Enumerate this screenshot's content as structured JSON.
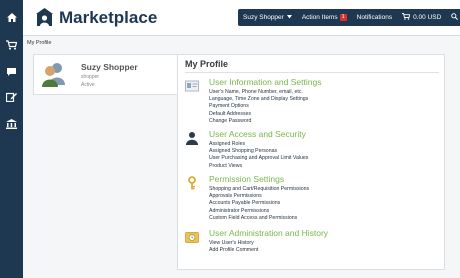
{
  "app": {
    "title": "Marketplace"
  },
  "colors": {
    "rail": "#1e3852",
    "accent_green": "#7ab64a",
    "badge_red": "#d9312b"
  },
  "rail_icons": [
    "home-icon",
    "cart-icon",
    "chat-icon",
    "edit-icon",
    "bank-icon"
  ],
  "topnav": {
    "user": "Suzy Shopper",
    "action_items_label": "Action Items",
    "action_items_count": "1",
    "notifications": "Notifications",
    "cart_amount": "0.00 USD"
  },
  "breadcrumb": "My Profile",
  "profile_card": {
    "name": "Suzy Shopper",
    "role": "shopper",
    "status": "Active"
  },
  "panel": {
    "title": "My Profile",
    "sections": [
      {
        "title": "User Information and Settings",
        "icon": "id-card-icon",
        "links": [
          "User's Name, Phone Number, email, etc.",
          "Language, Time Zone and Display Settings",
          "Payment Options",
          "Default Addresses",
          "Change Password"
        ]
      },
      {
        "title": "User Access and Security",
        "icon": "user-silhouette-icon",
        "links": [
          "Assigned Roles",
          "Assigned Shopping Personas",
          "User Purchasing and Approval Limit Values",
          "Product Views"
        ]
      },
      {
        "title": "Permission Settings",
        "icon": "key-icon",
        "links": [
          "Shopping and Cart/Requisition Permissions",
          "Approvals Permissions",
          "Accounts Payable Permissions",
          "Administrator Permissions",
          "Custom Field Access and Permissions"
        ]
      },
      {
        "title": "User Administration and History",
        "icon": "history-folder-icon",
        "links": [
          "View User's History",
          "Add Profile Comment"
        ]
      }
    ]
  }
}
